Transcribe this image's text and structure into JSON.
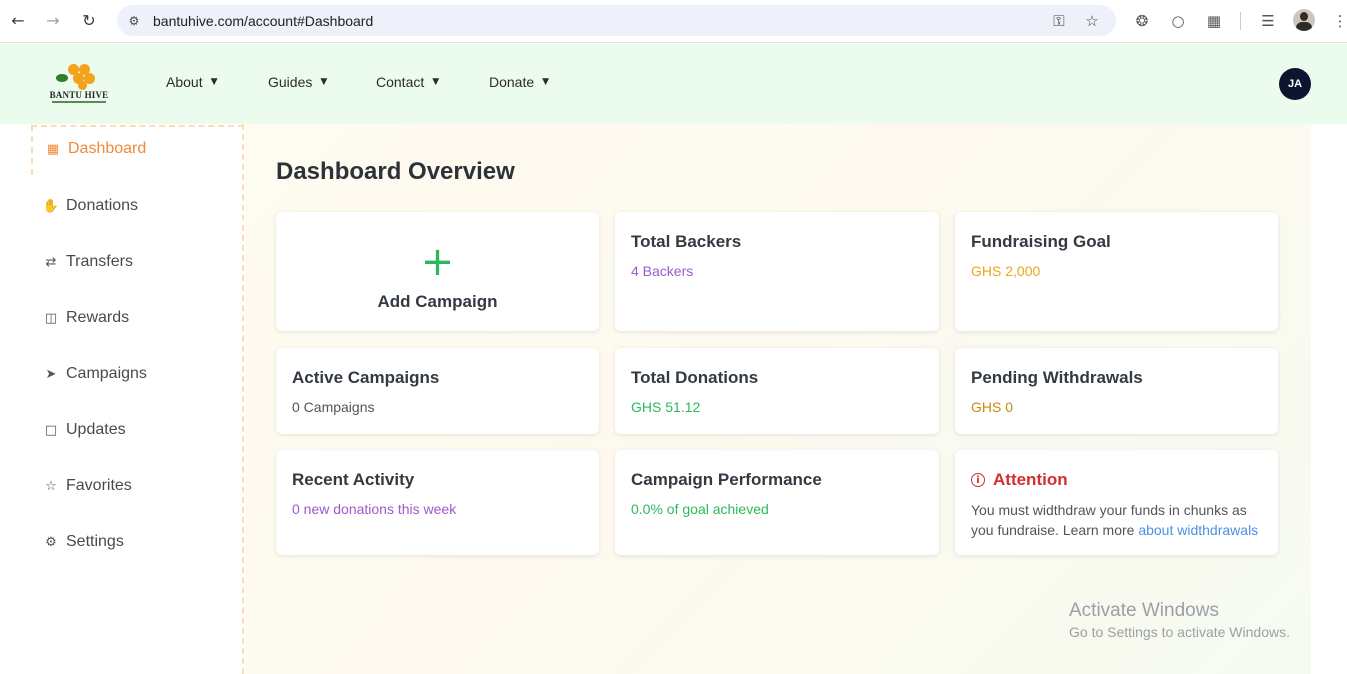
{
  "browser": {
    "url": "bantuhive.com/account#Dashboard"
  },
  "header": {
    "brand": "BANTU HIVE",
    "menu": [
      {
        "label": "About"
      },
      {
        "label": "Guides"
      },
      {
        "label": "Contact"
      },
      {
        "label": "Donate"
      }
    ],
    "avatar_initials": "JA"
  },
  "sidebar": {
    "items": [
      {
        "label": "Dashboard",
        "icon": "grid-icon",
        "active": true
      },
      {
        "label": "Donations",
        "icon": "hand-icon"
      },
      {
        "label": "Transfers",
        "icon": "arrows-icon"
      },
      {
        "label": "Rewards",
        "icon": "gift-icon"
      },
      {
        "label": "Campaigns",
        "icon": "rocket-icon"
      },
      {
        "label": "Updates",
        "icon": "chat-icon"
      },
      {
        "label": "Favorites",
        "icon": "star-icon"
      },
      {
        "label": "Settings",
        "icon": "gear-icon"
      }
    ]
  },
  "main": {
    "title": "Dashboard Overview",
    "add_campaign_label": "Add Campaign",
    "cards": {
      "total_backers": {
        "title": "Total Backers",
        "value": "4 Backers"
      },
      "fundraising_goal": {
        "title": "Fundraising Goal",
        "value": "GHS 2,000"
      },
      "active_campaigns": {
        "title": "Active Campaigns",
        "value": "0 Campaigns"
      },
      "total_donations": {
        "title": "Total Donations",
        "value": "GHS 51.12"
      },
      "pending_withdrawals": {
        "title": "Pending Withdrawals",
        "value": "GHS 0"
      },
      "recent_activity": {
        "title": "Recent Activity",
        "value": "0 new donations this week"
      },
      "campaign_performance": {
        "title": "Campaign Performance",
        "value": "0.0% of goal achieved"
      },
      "attention": {
        "title": "Attention",
        "message": "You must widthdraw your funds in chunks as you fundraise. Learn more ",
        "link_text": "about widthdrawals"
      }
    }
  },
  "watermark": {
    "line1": "Activate Windows",
    "line2": "Go to Settings to activate Windows."
  },
  "colors": {
    "accent_orange": "#f08a3c",
    "purple": "#9b59d0",
    "gold": "#e6a817",
    "green": "#2eb85c",
    "dark_gold": "#c98a0e",
    "red": "#d32f2f",
    "link_blue": "#4a90e2"
  }
}
